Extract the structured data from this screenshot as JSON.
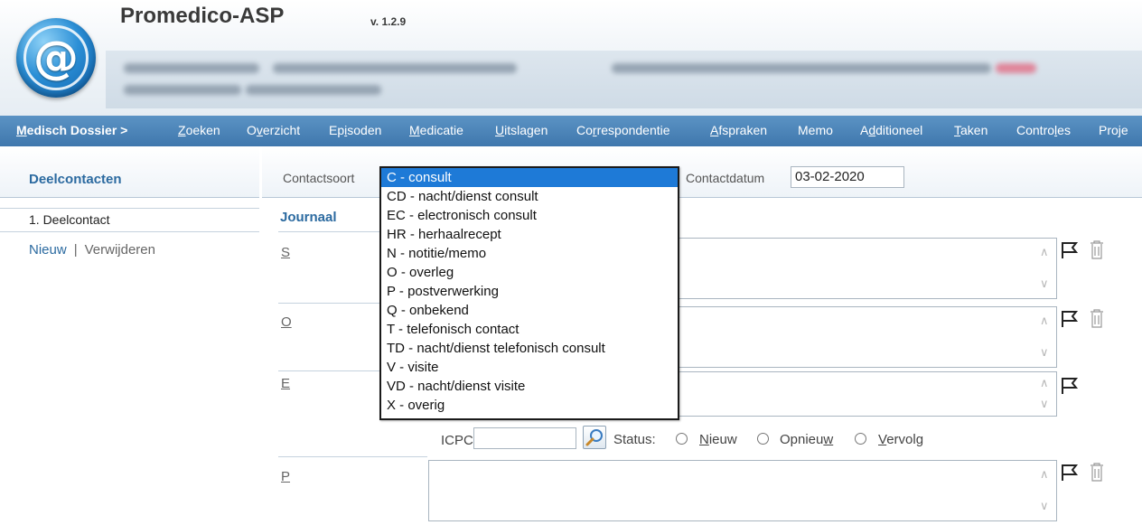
{
  "app": {
    "title": "Promedico-ASP",
    "version": "v. 1.2.9"
  },
  "nav": {
    "items": [
      {
        "pre": "",
        "u": "M",
        "post": "edisch Dossier >"
      },
      {
        "pre": "",
        "u": "Z",
        "post": "oeken"
      },
      {
        "pre": "O",
        "u": "v",
        "post": "erzicht"
      },
      {
        "pre": "Ep",
        "u": "i",
        "post": "soden"
      },
      {
        "pre": "",
        "u": "M",
        "post": "edicatie"
      },
      {
        "pre": "",
        "u": "U",
        "post": "itslagen"
      },
      {
        "pre": "Co",
        "u": "r",
        "post": "respondentie"
      },
      {
        "pre": "",
        "u": "A",
        "post": "fspraken"
      },
      {
        "pre": "Memo",
        "u": "",
        "post": ""
      },
      {
        "pre": "A",
        "u": "d",
        "post": "ditioneel"
      },
      {
        "pre": "",
        "u": "T",
        "post": "aken"
      },
      {
        "pre": "Contro",
        "u": "l",
        "post": "es"
      },
      {
        "pre": "Proje",
        "u": "",
        "post": ""
      }
    ]
  },
  "sidebar": {
    "title": "Deelcontacten",
    "active_item": "1. Deelcontact",
    "new_link": "Nieuw",
    "separator": "|",
    "delete_link": "Verwijderen"
  },
  "contact": {
    "type_label": "Contactsoort",
    "date_label": "Contactdatum",
    "date_value": "03-02-2020",
    "options": [
      "C - consult",
      "CD - nacht/dienst consult",
      "EC - electronisch consult",
      "HR - herhaalrecept",
      "N - notitie/memo",
      "O - overleg",
      "P - postverwerking",
      "Q - onbekend",
      "T - telefonisch contact",
      "TD - nacht/dienst telefonisch consult",
      "V - visite",
      "VD - nacht/dienst visite",
      "X - overig"
    ],
    "selected_index": 0
  },
  "journal": {
    "title": "Journaal",
    "sections": {
      "s": "S",
      "o": "O",
      "e": "E",
      "p": "P"
    }
  },
  "icpc": {
    "label": "ICPC",
    "value": "",
    "status_label": "Status:",
    "status_options": [
      {
        "pre": "",
        "u": "N",
        "post": "ieuw"
      },
      {
        "pre": "Opnieu",
        "u": "w",
        "post": ""
      },
      {
        "pre": "",
        "u": "V",
        "post": "ervolg"
      }
    ]
  },
  "icons": {
    "logo": "at-sign-logo",
    "flag": "flag-icon",
    "trash": "trash-icon",
    "search": "magnifier-icon",
    "scroll_up": "chevron-up-icon",
    "scroll_down": "chevron-down-icon"
  },
  "colors": {
    "nav_bar": "#4a84ba",
    "accent_text": "#2b6aa0",
    "selection": "#1e7ad7"
  }
}
